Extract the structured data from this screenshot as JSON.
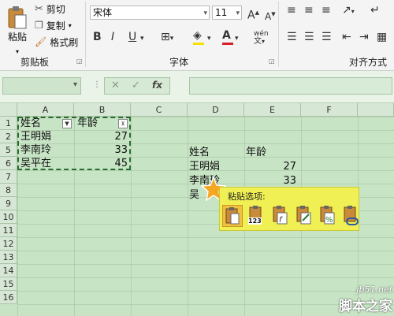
{
  "ribbon": {
    "clipboard": {
      "paste": "粘贴",
      "cut": "剪切",
      "copy": "复制",
      "format_painter": "格式刷",
      "group": "剪贴板"
    },
    "font": {
      "name": "宋体",
      "size": "11",
      "bold": "B",
      "italic": "I",
      "underline": "U",
      "phonetic": "wén",
      "group": "字体"
    },
    "alignment": {
      "group": "对齐方式"
    },
    "colors": {
      "highlight": "#f5e100",
      "font_color": "#d8202a"
    }
  },
  "formula_bar": {
    "fx": "fx"
  },
  "grid": {
    "columns": [
      "A",
      "B",
      "C",
      "D",
      "E",
      "F"
    ],
    "rows": [
      "1",
      "2",
      "5",
      "6",
      "7",
      "8",
      "9",
      "10",
      "11",
      "12",
      "13",
      "14",
      "15",
      "16"
    ],
    "source": {
      "header_name": "姓名",
      "header_age": "年龄",
      "rows": [
        {
          "name": "王明娟",
          "age": "27"
        },
        {
          "name": "李南玲",
          "age": "33"
        },
        {
          "name": "吴平在",
          "age": "45"
        }
      ]
    },
    "pasted": {
      "header_name": "姓名",
      "header_age": "年龄",
      "rows": [
        {
          "name": "王明娟",
          "age": "27"
        },
        {
          "name": "李南玲",
          "age": "33"
        },
        {
          "name": "吴",
          "age": ""
        }
      ]
    }
  },
  "paste_options": {
    "title": "粘贴选项:",
    "value_label": "123"
  },
  "watermark": {
    "line1": "jb51.net",
    "line2": "脚本之家"
  }
}
